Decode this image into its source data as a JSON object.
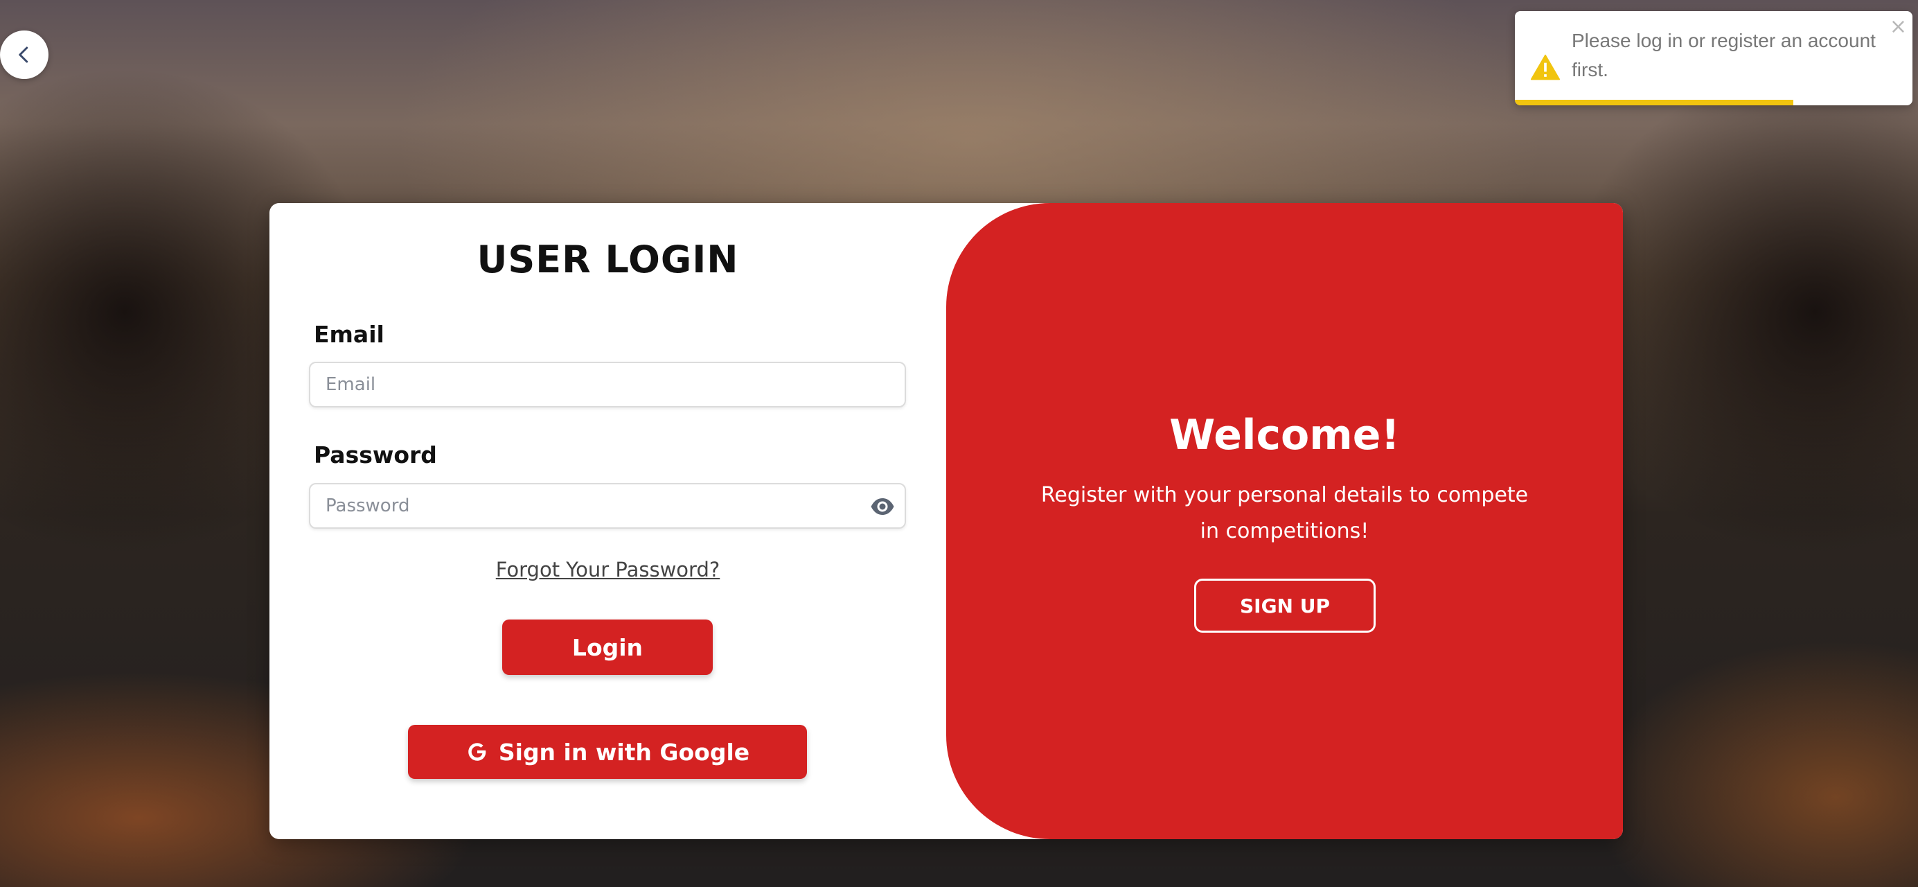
{
  "back_button": {
    "icon": "chevron-left-icon"
  },
  "toast": {
    "icon": "warning-icon",
    "message": "Please log in or register an account first.",
    "close_label": "×",
    "progress": 0.7,
    "colors": {
      "warning": "#f1c40f",
      "text": "#777777"
    }
  },
  "login": {
    "title": "USER LOGIN",
    "email_label": "Email",
    "email_placeholder": "Email",
    "email_value": "",
    "password_label": "Password",
    "password_placeholder": "Password",
    "password_value": "",
    "password_toggle_icon": "eye-icon",
    "forgot_label": "Forgot Your Password?",
    "login_button": "Login",
    "google_button": "Sign in with Google",
    "google_icon": "google-icon"
  },
  "welcome": {
    "title": "Welcome!",
    "text": "Register with your personal details to compete in competitions!",
    "signup_button": "SIGN UP"
  },
  "colors": {
    "accent": "#d42222",
    "card": "#ffffff"
  }
}
